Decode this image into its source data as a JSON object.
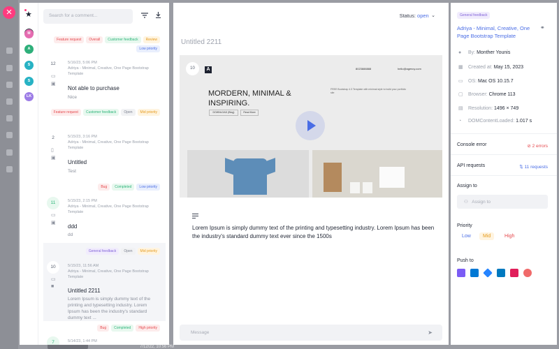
{
  "background": {
    "timestamp": "7/12/22, 10:56 PM"
  },
  "rail": {
    "avatars": [
      {
        "initial": "M",
        "color": "#e56cb1"
      },
      {
        "initial": "A",
        "color": "#2eaf7a"
      },
      {
        "initial": "S",
        "color": "#27b2c4"
      },
      {
        "initial": "S",
        "color": "#27b2c4"
      },
      {
        "initial": "LK",
        "color": "#9c7ce6"
      }
    ]
  },
  "list": {
    "search_placeholder": "Search for a comment...",
    "cards": [
      {
        "tags": [
          "Feature request",
          "Overall",
          "Customer feedback",
          "Review",
          "Low priority"
        ],
        "number": "12",
        "meta": "5/16/23, 5:06 PM\nAdriya - Minimal, Creative, One Page Bootstrap Template",
        "title": "Not able to purchase",
        "body": "Nice"
      },
      {
        "tags": [
          "Feature request",
          "Customer feedback",
          "Open",
          "Mid priority"
        ],
        "number": "2",
        "meta": "5/15/23, 3:16 PM\nAdriya - Minimal, Creative, One Page Bootstrap Template",
        "title": "Untitled",
        "body": "Test"
      },
      {
        "tags": [
          "Bug",
          "Completed",
          "Low priority"
        ],
        "number": "11",
        "meta": "5/15/23, 2:15 PM\nAdriya - Minimal, Creative, One Page Bootstrap Template",
        "title": "ddd",
        "body": "dd"
      },
      {
        "tags": [
          "General feedback",
          "Open",
          "Mid priority"
        ],
        "number": "10",
        "meta": "5/15/23, 11:56 AM\nAdriya - Minimal, Creative, One Page Bootstrap Template",
        "title": "Untitled 2211",
        "body": "Lorem Ipsum is simply dummy text of the printing and typesetting industry. Lorem Ipsum has been the industry's standard dummy text ..."
      },
      {
        "tags": [
          "Bug",
          "Completed",
          "High priority"
        ],
        "number": "7",
        "meta": "5/14/23, 1:44 PM",
        "title": "",
        "body": ""
      }
    ]
  },
  "detail": {
    "status_label": "Status:",
    "status_value": "open",
    "title": "Untitled 2211",
    "screenshot": {
      "number": "10",
      "logo": "A",
      "nav_email": "hello@agency.com",
      "nav_phone": "8023888888",
      "hero": "MORDERN, MINIMAL & INSPIRING.",
      "description": "FREE Bootstrap 4.3 Template with minimal style to build your portfolio site",
      "button_1": "DOWNLOAD (Blog)",
      "button_2": "Read More"
    },
    "description": "Lorem Ipsum is simply dummy text of the printing and typesetting industry. Lorem Ipsum has been the industry's standard dummy text ever since the 1500s",
    "message_placeholder": "Message"
  },
  "info": {
    "tag": "General feedback",
    "title": "Adriya - Minimal, Creative, One Page Bootstrap Template",
    "rows": [
      {
        "icon": "user-icon",
        "label": "By:",
        "value": "Monther Younis"
      },
      {
        "icon": "calendar-icon",
        "label": "Created at:",
        "value": "May 15, 2023"
      },
      {
        "icon": "os-icon",
        "label": "OS:",
        "value": "Mac OS 10.15.7"
      },
      {
        "icon": "browser-icon",
        "label": "Browser:",
        "value": "Chrome 113"
      },
      {
        "icon": "resolution-icon",
        "label": "Resolution:",
        "value": "1496 × 749"
      },
      {
        "icon": "timer-icon",
        "label": "DOMContentLoaded:",
        "value": "1.017 s"
      }
    ],
    "console_label": "Console error",
    "console_value": "2 errors",
    "api_label": "API requests",
    "api_value": "11 requests",
    "assign_label": "Assign to",
    "assign_placeholder": "Assign to",
    "priority_label": "Priority",
    "priority_options": [
      "Low",
      "Mid",
      "High"
    ],
    "priority_selected": "Mid",
    "push_label": "Push to",
    "push_targets": [
      {
        "name": "clickup-icon",
        "color": "#7b5cf5"
      },
      {
        "name": "azure-devops-icon",
        "color": "#0078d4"
      },
      {
        "name": "jira-icon",
        "color": "#2684ff"
      },
      {
        "name": "trello-icon",
        "color": "#0079bf"
      },
      {
        "name": "slack-icon",
        "color": "#e01e5a"
      },
      {
        "name": "asana-icon",
        "color": "#f06a6a"
      }
    ]
  },
  "colors": {
    "accent": "#4a6de5",
    "close": "#ff3b7f"
  }
}
